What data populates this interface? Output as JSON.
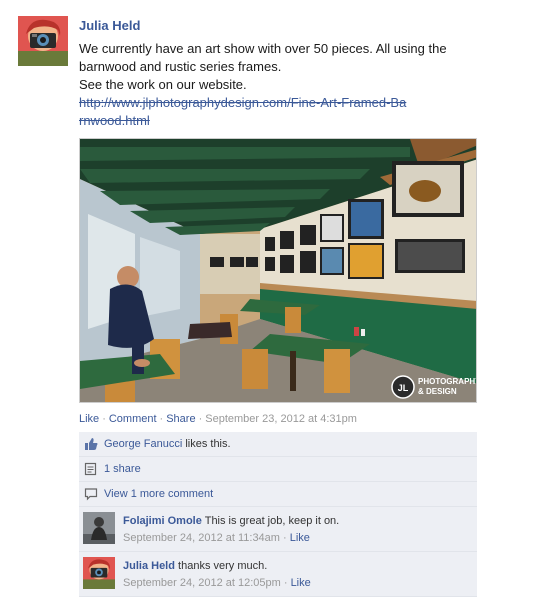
{
  "post": {
    "author": "Julia Held",
    "lines": [
      "We currently have an art show with over 50 pieces. All using the",
      "barnwood and rustic series frames.",
      "See the work on our website."
    ],
    "url": "http://www.jlphotographydesign.com/Fine-Art-Framed-Barnwood.html",
    "photo_logo_line1": "PHOTOGRAPHY",
    "photo_logo_line2": "& DESIGN",
    "photo_logo_mark": "JL"
  },
  "actions": {
    "like": "Like",
    "comment": "Comment",
    "share": "Share",
    "timestamp": "September 23, 2012 at 4:31pm"
  },
  "ufi": {
    "likers": "George Fanucci",
    "likes_suffix": " likes this.",
    "shares": "1 share",
    "view_more": "View 1 more comment"
  },
  "comments": [
    {
      "name": "Folajimi Omole",
      "text": "This is great job, keep it on.",
      "time": "September 24, 2012 at 11:34am",
      "like": "Like"
    },
    {
      "name": "Julia Held",
      "text": "thanks very much.",
      "time": "September 24, 2012 at 12:05pm",
      "like": "Like"
    }
  ],
  "icons": {
    "thumbs_up": "thumbs-up-icon",
    "share": "share-icon",
    "comment": "comment-icon"
  },
  "colors": {
    "link": "#3b5998",
    "ufi_bg": "#edeff4",
    "meta": "#999999"
  }
}
